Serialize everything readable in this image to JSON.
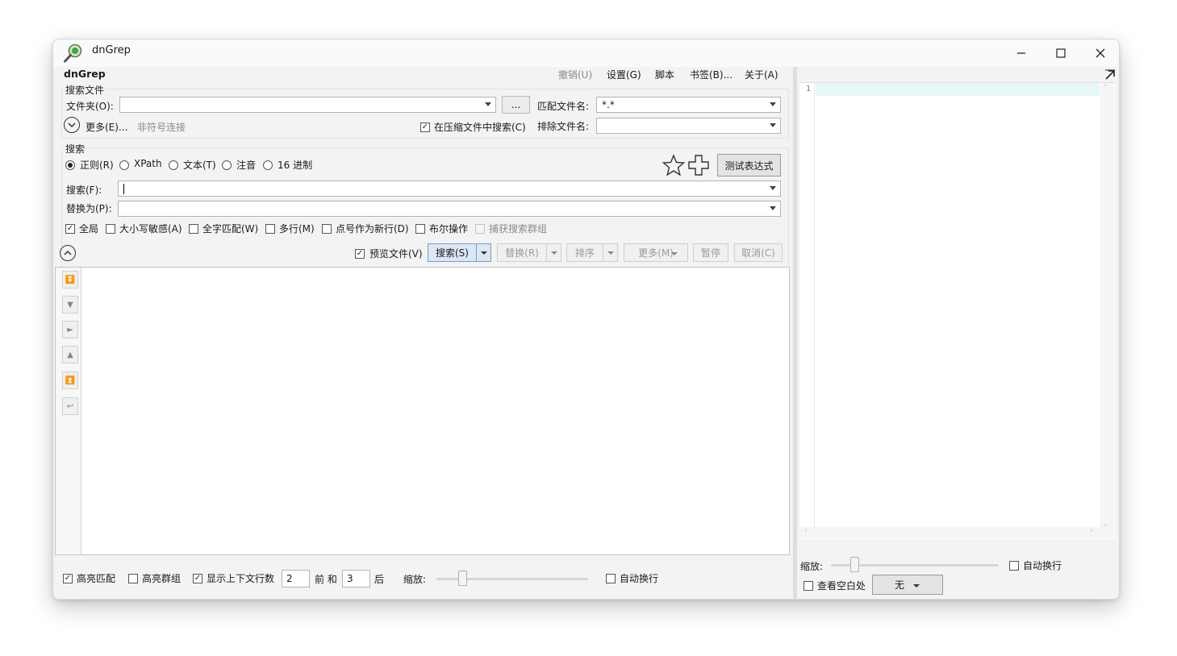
{
  "window": {
    "title": "dnGrep",
    "minimize_icon": "minimize-icon",
    "maximize_icon": "maximize-icon",
    "close_icon": "close-icon"
  },
  "app_name": "dnGrep",
  "menu": {
    "undo": "撤销(U)",
    "settings": "设置(G)",
    "script": "脚本",
    "bookmarks": "书签(B)...",
    "about": "关于(A)"
  },
  "search_files": {
    "group_label": "搜索文件",
    "folder_label": "文件夹(O):",
    "folder_value": "",
    "browse_label": "...",
    "match_files_label": "匹配文件名:",
    "match_files_value": "*.*",
    "more_label": "更多(E)...",
    "pattern_note": "非符号连接",
    "search_archives_label": "在压缩文件中搜索(C)",
    "search_archives_checked": true,
    "exclude_label": "排除文件名:",
    "exclude_value": ""
  },
  "search": {
    "group_label": "搜索",
    "modes": [
      {
        "label": "正则(R)",
        "selected": true
      },
      {
        "label": "XPath",
        "selected": false
      },
      {
        "label": "文本(T)",
        "selected": false
      },
      {
        "label": "注音",
        "selected": false
      },
      {
        "label": "16 进制",
        "selected": false
      }
    ],
    "test_regex_label": "测试表达式",
    "search_label": "搜索(F):",
    "search_value": "",
    "replace_label": "替换为(P):",
    "replace_value": "",
    "options": [
      {
        "label": "全局",
        "checked": true,
        "enabled": true
      },
      {
        "label": "大小写敏感(A)",
        "checked": false,
        "enabled": true
      },
      {
        "label": "全字匹配(W)",
        "checked": false,
        "enabled": true
      },
      {
        "label": "多行(M)",
        "checked": false,
        "enabled": true
      },
      {
        "label": "点号作为新行(D)",
        "checked": false,
        "enabled": true
      },
      {
        "label": "布尔操作",
        "checked": false,
        "enabled": true
      },
      {
        "label": "捕获搜索群组",
        "checked": false,
        "enabled": false
      }
    ]
  },
  "actions": {
    "preview_label": "预览文件(V)",
    "preview_checked": true,
    "search_btn": "搜索(S)",
    "replace_btn": "替换(R)",
    "sort_btn": "排序",
    "more_btn": "更多(M)",
    "pause_btn": "暂停",
    "cancel_btn": "取消(C)"
  },
  "bottom": {
    "highlight_matches": "高亮匹配",
    "highlight_matches_checked": true,
    "highlight_groups": "高亮群组",
    "highlight_groups_checked": false,
    "show_context": "显示上下文行数",
    "show_context_checked": true,
    "before_value": "2",
    "before_label": "前 和",
    "after_value": "3",
    "after_label": "后",
    "zoom_label": "缩放:",
    "word_wrap": "自动换行",
    "word_wrap_checked": false
  },
  "preview": {
    "line_number": "1",
    "zoom_label": "缩放:",
    "word_wrap": "自动换行",
    "word_wrap_checked": false,
    "show_whitespace": "查看空白处",
    "show_whitespace_checked": false,
    "syntax_value": "无"
  },
  "colors": {
    "current_line": "#e6f7f7",
    "accent_button": "#dbe8f4"
  }
}
